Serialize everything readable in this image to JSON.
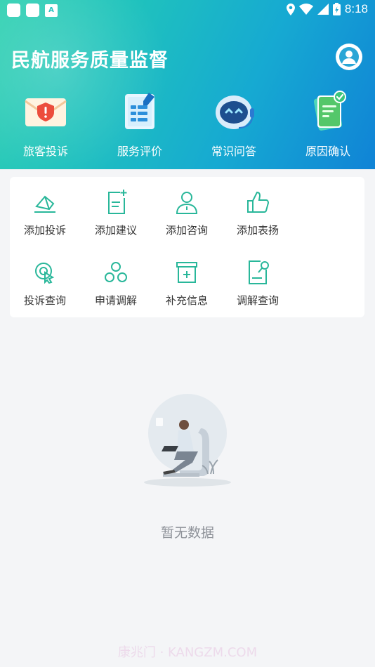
{
  "status": {
    "time": "8:18",
    "a_badge": "A"
  },
  "header": {
    "title": "民航服务质量监督"
  },
  "quick_actions": [
    {
      "label": "旅客投诉",
      "icon": "complaint-envelope-icon"
    },
    {
      "label": "服务评价",
      "icon": "evaluation-doc-icon"
    },
    {
      "label": "常识问答",
      "icon": "robot-qa-icon"
    },
    {
      "label": "原因确认",
      "icon": "confirm-doc-icon"
    }
  ],
  "grid": [
    {
      "label": "添加投诉",
      "icon": "eraser-icon"
    },
    {
      "label": "添加建议",
      "icon": "doc-plus-icon"
    },
    {
      "label": "添加咨询",
      "icon": "person-icon"
    },
    {
      "label": "添加表扬",
      "icon": "thumbs-up-icon"
    },
    {
      "label": "投诉查询",
      "icon": "search-click-icon"
    },
    {
      "label": "申请调解",
      "icon": "circles-icon"
    },
    {
      "label": "补充信息",
      "icon": "box-plus-icon"
    },
    {
      "label": "调解查询",
      "icon": "doc-search-icon"
    }
  ],
  "empty": {
    "text": "暂无数据"
  },
  "watermark": "康兆门 · KANGZM.COM",
  "colors": {
    "accent": "#2bbf9f",
    "header_start": "#35d2b3",
    "header_end": "#1083d6"
  }
}
